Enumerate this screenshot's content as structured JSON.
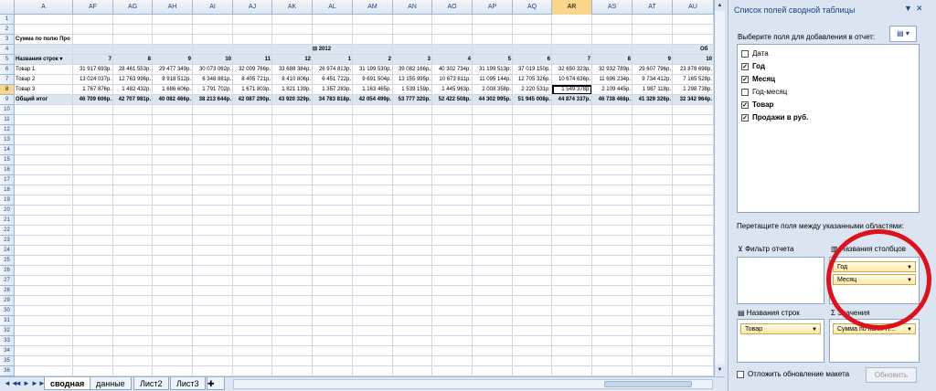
{
  "sheet": {
    "columns": [
      "A",
      "AF",
      "AG",
      "AH",
      "AI",
      "AJ",
      "AK",
      "AL",
      "AM",
      "AN",
      "AO",
      "AP",
      "AQ",
      "AR",
      "AS",
      "AT",
      "AU"
    ],
    "selected_column": "AR",
    "rows": [
      "1",
      "2",
      "3",
      "4",
      "5",
      "6",
      "7",
      "8",
      "9",
      "10",
      "11",
      "12",
      "13",
      "14",
      "15",
      "16",
      "17",
      "18",
      "19",
      "20",
      "21",
      "22",
      "23",
      "24",
      "25",
      "26",
      "27",
      "28",
      "29",
      "30",
      "31",
      "32",
      "33",
      "34",
      "35",
      "36"
    ],
    "selected_row": "8",
    "pivot": {
      "title": "Сумма по полю Про",
      "year_label": "2012",
      "overall_label": "Об",
      "row_label_header": "Названия строк",
      "month_headers": [
        "7",
        "8",
        "9",
        "10",
        "11",
        "12",
        "1",
        "2",
        "3",
        "4",
        "5",
        "6",
        "7",
        "8",
        "9",
        "10"
      ],
      "rows": [
        {
          "label": "Товар 1",
          "values": [
            "31 917 693р.",
            "28 461 553р.",
            "29 477 349р.",
            "30 073 062р.",
            "32 009 766р.",
            "33 688 384р.",
            "26 974 813р.",
            "31 199 530р.",
            "39 082 166р.",
            "40 302 734р.",
            "31 199 513р.",
            "37 019 150р.",
            "32 650 323р.",
            "32 932 789р.",
            "29 607 796р.",
            "23 878 698р.",
            "1"
          ]
        },
        {
          "label": "Товар 2",
          "values": [
            "13 024 037р.",
            "12 763 996р.",
            "8 918 512р.",
            "6 348 881р.",
            "8 405 721р.",
            "8 410 806р.",
            "6 451 722р.",
            "9 691 504р.",
            "13 155 995р.",
            "10 673 811р.",
            "11 095 144р.",
            "12 705 326р.",
            "10 674 636р.",
            "11 696 234р.",
            "9 734 412р.",
            "7 165 528р.",
            "4"
          ]
        },
        {
          "label": "Товар 3",
          "values": [
            "1 767 876р.",
            "1 482 432р.",
            "1 686 606р.",
            "1 791 702р.",
            "1 671 803р.",
            "1 821 139р.",
            "1 357 283р.",
            "1 163 465р.",
            "1 539 159р.",
            "1 445 963р.",
            "2 008 358р.",
            "2 220 531р.",
            "1 549 378р.",
            "2 109 445р.",
            "1 987 118р.",
            "1 298 738р.",
            ""
          ]
        }
      ],
      "total": {
        "label": "Общий итог",
        "values": [
          "46 709 606р.",
          "42 707 981р.",
          "40 082 466р.",
          "38 213 644р.",
          "42 087 290р.",
          "43 920 329р.",
          "34 783 818р.",
          "42 054 499р.",
          "53 777 320р.",
          "52 422 508р.",
          "44 302 995р.",
          "51 945 008р.",
          "44 874 337р.",
          "46 738 468р.",
          "41 329 326р.",
          "32 342 964р.",
          "1"
        ]
      }
    }
  },
  "tabs": {
    "nav": [
      "◄◄",
      "◄",
      "►",
      "►►"
    ],
    "items": [
      "сводная",
      "данные",
      "Лист2",
      "Лист3"
    ],
    "active": "сводная"
  },
  "panel": {
    "title": "Список полей сводной таблицы",
    "choose_label": "Выберите поля для добавления в отчет:",
    "fields": [
      {
        "label": "Дата",
        "checked": false,
        "bold": false
      },
      {
        "label": "Год",
        "checked": true,
        "bold": true
      },
      {
        "label": "Месяц",
        "checked": true,
        "bold": true
      },
      {
        "label": "Год-месяц",
        "checked": false,
        "bold": false
      },
      {
        "label": "Товар",
        "checked": true,
        "bold": true
      },
      {
        "label": "Продажи в руб.",
        "checked": true,
        "bold": true
      }
    ],
    "drag_hint": "Перетащите поля между указанными областями:",
    "report_filter_label": "Фильтр отчета",
    "column_labels_label": "Названия столбцов",
    "row_labels_label": "Названия строк",
    "values_label": "Значения",
    "column_chips": [
      "Год",
      "Месяц"
    ],
    "row_chips": [
      "Товар"
    ],
    "value_chips": [
      "Сумма по полю П..."
    ],
    "defer_label": "Отложить обновление макета",
    "update_button": "Обновить"
  },
  "colors": {
    "highlight": "#e0101a",
    "selection": "#f9d68b"
  }
}
